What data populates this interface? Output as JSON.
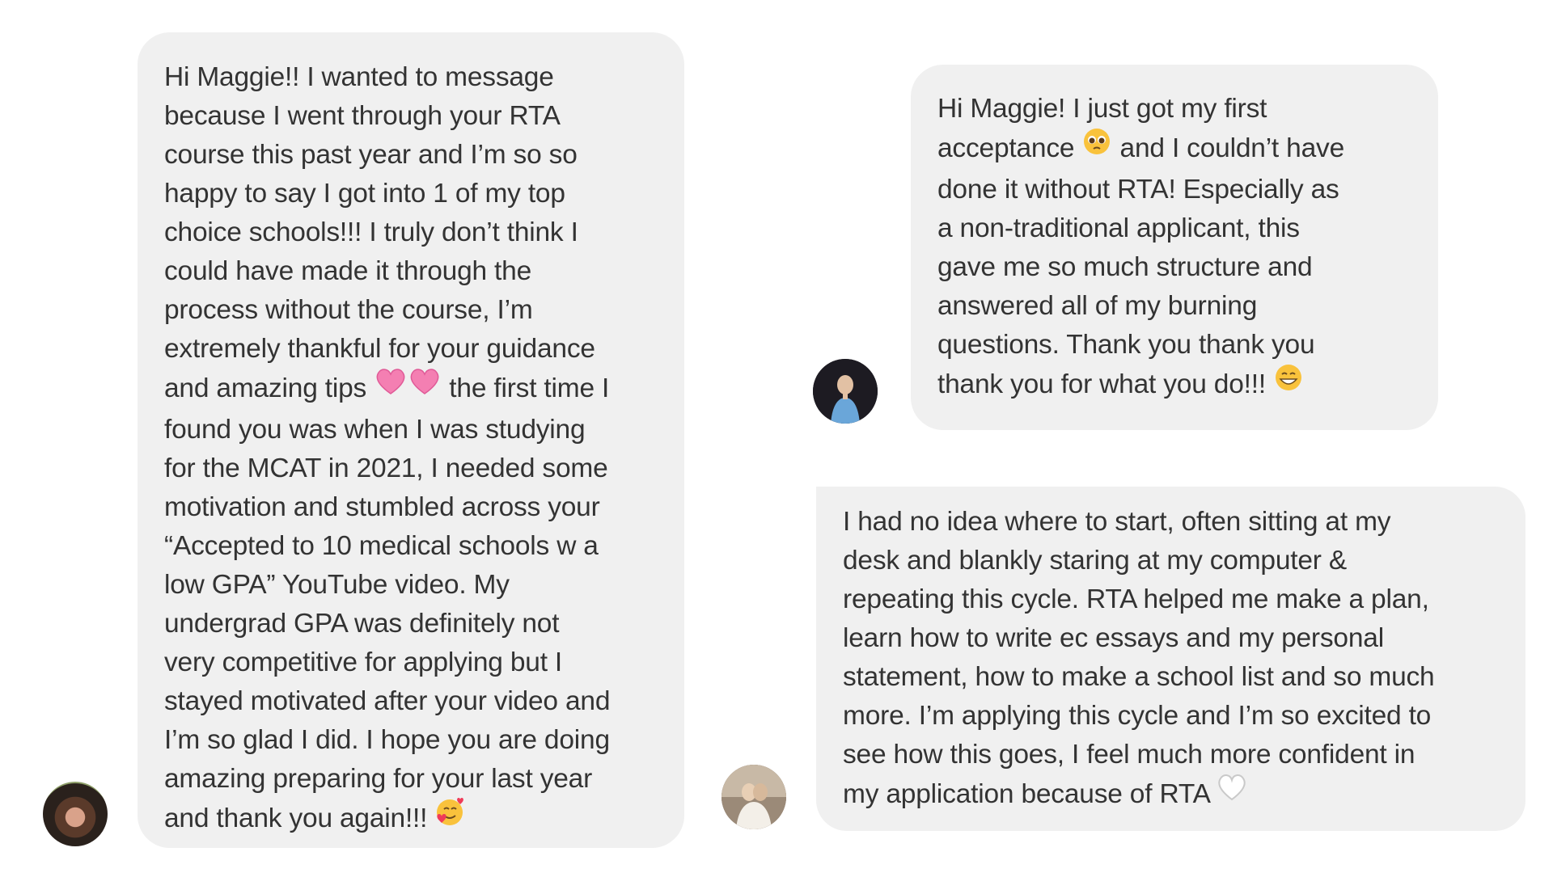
{
  "messages": [
    {
      "lines": [
        "Hi Maggie!! I wanted to message",
        "because I went through your RTA",
        "course this past year and I’m so so",
        "happy to say I got into 1 of my top",
        "choice schools!!! I truly don’t think I",
        "could have made it through the",
        "process without the course, I’m",
        "extremely thankful for your guidance",
        [
          "and amazing tips ",
          " the first time I"
        ],
        "found you was when I was studying",
        "for the MCAT in 2021, I needed some",
        "motivation and stumbled across your",
        "“Accepted to 10 medical schools w a",
        "low GPA” YouTube video. My",
        "undergrad GPA was definitely not",
        "very competitive for applying but I",
        "stayed motivated after your video and",
        "I’m so glad I did. I hope you are doing",
        "amazing preparing for your last year",
        "and thank you again!!! "
      ],
      "emojis": [
        "two-hearts-emoji",
        "smiling-hearts-emoji"
      ]
    },
    {
      "lines": [
        "Hi Maggie! I just got my first",
        [
          "acceptance ",
          " and I couldn’t have"
        ],
        "done it without RTA! Especially as",
        "a non-traditional applicant, this",
        "gave me so much structure and",
        "answered all of my burning",
        "questions. Thank you thank you",
        "thank you for what you do!!! "
      ],
      "emojis": [
        "pleading-face-emoji",
        "grinning-face-emoji"
      ]
    },
    {
      "lines": [
        "I had no idea where to start, often sitting at my",
        "desk and blankly staring at my computer &",
        "repeating this cycle. RTA helped me make a plan,",
        "learn how to write ec essays and my personal",
        "statement, how to make a school list and so much",
        "more. I’m applying this cycle and I’m so excited to",
        "see how this goes, I feel much more confident in",
        "my application because of RTA "
      ],
      "emojis": [
        "white-heart-emoji"
      ]
    }
  ],
  "colors": {
    "bubble": "#f0f0f0",
    "text": "#333333",
    "background": "#ffffff"
  }
}
